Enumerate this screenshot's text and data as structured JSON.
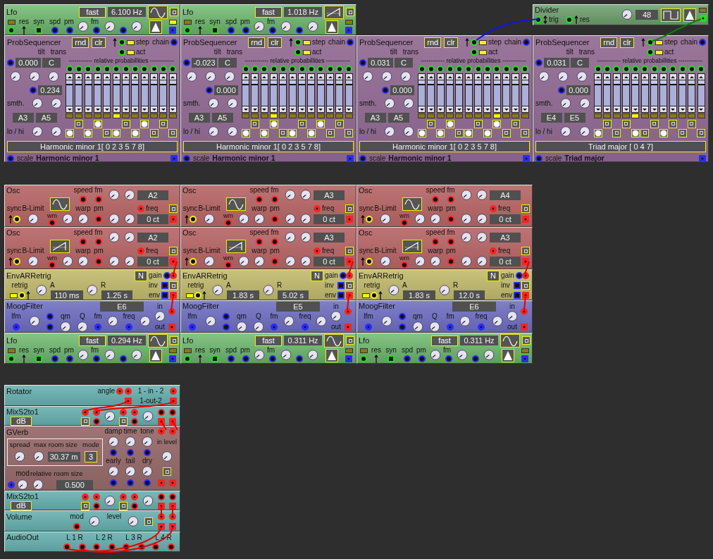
{
  "top_row": [
    {
      "kind": "lfo",
      "title": "Lfo",
      "mode": "fast",
      "rate": "6.100 Hz",
      "waveform": {
        "kind": "sine"
      },
      "led_on": true,
      "res": "res",
      "syn": "syn",
      "spd": "spd",
      "pm": "pm",
      "fm": "fm"
    },
    {
      "kind": "lfo",
      "title": "Lfo",
      "mode": "fast",
      "rate": "1.018 Hz",
      "waveform": {
        "kind": "saw"
      },
      "led_on": false,
      "res": "res",
      "syn": "syn",
      "spd": "spd",
      "pm": "pm",
      "fm": "fm"
    },
    {
      "kind": "divider",
      "title": "Divider",
      "trig": "trig",
      "res": "res",
      "value": "48"
    }
  ],
  "sequencers": [
    {
      "title": "ProbSequencer",
      "rnd": "rnd",
      "clr": "clr",
      "step": "step",
      "chain": "chain",
      "act": "act",
      "tilt_label": "tilt",
      "trans_label": "trans",
      "tilt": "0.000",
      "trans": "C",
      "heading": "------------ relative probabillities ------------",
      "smooth_label": "smth.",
      "smooth": "0.234",
      "lo": "A3",
      "hi": "A5",
      "range_label": "lo / hi",
      "scale_display": "Harmonic minor 1[ 0 2 3 5 7 8]",
      "scale_label": "scale",
      "scale_name": "Harmonic minor 1",
      "steps": [
        {
          "level": 0.74,
          "active": false,
          "on": true
        },
        {
          "level": 0.74,
          "active": false,
          "on": false
        },
        {
          "level": 0.74,
          "active": false,
          "on": true
        },
        {
          "level": 0.74,
          "active": false,
          "on": true
        },
        {
          "level": 0.74,
          "active": false,
          "on": false
        },
        {
          "level": 0.74,
          "active": true,
          "on": true
        },
        {
          "level": 0.74,
          "active": false,
          "on": false
        },
        {
          "level": 0.74,
          "active": false,
          "on": true
        },
        {
          "level": 0.74,
          "active": false,
          "on": true
        },
        {
          "level": 0.74,
          "active": false,
          "on": false
        },
        {
          "level": 0.74,
          "active": false,
          "on": false
        },
        {
          "level": 0.74,
          "active": false,
          "on": false
        }
      ]
    },
    {
      "title": "ProbSequencer",
      "rnd": "rnd",
      "clr": "clr",
      "step": "step",
      "chain": "chain",
      "act": "act",
      "tilt_label": "tilt",
      "trans_label": "trans",
      "tilt": "-0.023",
      "trans": "C",
      "heading": "------------ relative probabillities ------------",
      "smooth_label": "smth.",
      "smooth": "0.000",
      "lo": "A3",
      "hi": "A5",
      "range_label": "lo / hi",
      "scale_display": "Harmonic minor 1[ 0 2 3 5 7 8]",
      "scale_label": "scale",
      "scale_name": "Harmonic minor 1",
      "steps": [
        {
          "level": 0.74,
          "active": false,
          "on": true
        },
        {
          "level": 0.74,
          "active": false,
          "on": false
        },
        {
          "level": 0.74,
          "active": false,
          "on": true
        },
        {
          "level": 0.74,
          "active": true,
          "on": true
        },
        {
          "level": 0.74,
          "active": false,
          "on": false
        },
        {
          "level": 0.74,
          "active": false,
          "on": true
        },
        {
          "level": 0.74,
          "active": false,
          "on": false
        },
        {
          "level": 0.74,
          "active": false,
          "on": true
        },
        {
          "level": 0.74,
          "active": false,
          "on": true
        },
        {
          "level": 0.74,
          "active": false,
          "on": false
        },
        {
          "level": 0.74,
          "active": false,
          "on": false
        },
        {
          "level": 0.74,
          "active": false,
          "on": false
        }
      ]
    },
    {
      "title": "ProbSequencer",
      "rnd": "rnd",
      "clr": "clr",
      "step": "step",
      "chain": "chain",
      "act": "act",
      "tilt_label": "tilt",
      "trans_label": "trans",
      "tilt": "0.031",
      "trans": "C",
      "heading": "------------ relative probabillities ------------",
      "smooth_label": "smth.",
      "smooth": "0.000",
      "lo": "A3",
      "hi": "A5",
      "range_label": "lo / hi",
      "scale_display": "Harmonic minor 1[ 0 2 3 5 7 8]",
      "scale_label": "scale",
      "scale_name": "Harmonic minor 1",
      "steps": [
        {
          "level": 0.74,
          "active": false,
          "on": true
        },
        {
          "level": 0.74,
          "active": false,
          "on": false
        },
        {
          "level": 0.74,
          "active": false,
          "on": true
        },
        {
          "level": 0.74,
          "active": false,
          "on": true
        },
        {
          "level": 0.74,
          "active": false,
          "on": false
        },
        {
          "level": 0.74,
          "active": false,
          "on": true
        },
        {
          "level": 0.74,
          "active": false,
          "on": false
        },
        {
          "level": 0.74,
          "active": false,
          "on": true
        },
        {
          "level": 0.74,
          "active": true,
          "on": true
        },
        {
          "level": 0.74,
          "active": false,
          "on": false
        },
        {
          "level": 0.74,
          "active": false,
          "on": false
        },
        {
          "level": 0.74,
          "active": false,
          "on": false
        }
      ]
    },
    {
      "title": "ProbSequencer",
      "rnd": "rnd",
      "clr": "clr",
      "step": "step",
      "chain": "chain",
      "act": "act",
      "tilt_label": "tilt",
      "trans_label": "trans",
      "tilt": "0.031",
      "trans": "C",
      "heading": "------------ relative probabillities ------------",
      "smooth_label": "smth.",
      "smooth": "0.000",
      "lo": "E4",
      "hi": "E5",
      "range_label": "lo / hi",
      "scale_display": "Triad major [ 0 4 7]",
      "scale_label": "scale",
      "scale_name": "Triad major",
      "steps": [
        {
          "level": 0.74,
          "active": false,
          "on": true
        },
        {
          "level": 0.74,
          "active": false,
          "on": false
        },
        {
          "level": 0.74,
          "active": false,
          "on": false
        },
        {
          "level": 0.74,
          "active": false,
          "on": false
        },
        {
          "level": 0.74,
          "active": true,
          "on": true
        },
        {
          "level": 0.74,
          "active": false,
          "on": false
        },
        {
          "level": 0.74,
          "active": false,
          "on": false
        },
        {
          "level": 0.74,
          "active": false,
          "on": true
        },
        {
          "level": 0.74,
          "active": false,
          "on": false
        },
        {
          "level": 0.74,
          "active": false,
          "on": false
        },
        {
          "level": 0.74,
          "active": false,
          "on": false
        },
        {
          "level": 0.74,
          "active": false,
          "on": false
        }
      ]
    }
  ],
  "voice_rows": [
    [
      {
        "kind": "osc",
        "title": "Osc",
        "speed": "speed",
        "fm": "fm",
        "blimit": "B-Limit",
        "wm": "wm",
        "warp": "warp",
        "pm": "pm",
        "sync": "sync",
        "freq": "freq",
        "note": "A2",
        "tune": "0 ct",
        "waveform": {
          "kind": "sine"
        }
      },
      {
        "kind": "osc",
        "title": "Osc",
        "speed": "speed",
        "fm": "fm",
        "blimit": "B-Limit",
        "wm": "wm",
        "warp": "warp",
        "pm": "pm",
        "sync": "sync",
        "freq": "freq",
        "note": "A3",
        "tune": "0 ct",
        "waveform": {
          "kind": "sine"
        }
      },
      {
        "kind": "osc",
        "title": "Osc",
        "speed": "speed",
        "fm": "fm",
        "blimit": "B-Limit",
        "wm": "wm",
        "warp": "warp",
        "pm": "pm",
        "sync": "sync",
        "freq": "freq",
        "note": "A4",
        "tune": "0 ct",
        "waveform": {
          "kind": "sine"
        }
      }
    ],
    [
      {
        "kind": "osc",
        "title": "Osc",
        "speed": "speed",
        "fm": "fm",
        "blimit": "B-Limit",
        "wm": "wm",
        "warp": "warp",
        "pm": "pm",
        "sync": "sync",
        "freq": "freq",
        "note": "A2",
        "tune": "0 ct",
        "waveform": {
          "kind": "saw"
        }
      },
      {
        "kind": "osc",
        "title": "Osc",
        "speed": "speed",
        "fm": "fm",
        "blimit": "B-Limit",
        "wm": "wm",
        "warp": "warp",
        "pm": "pm",
        "sync": "sync",
        "freq": "freq",
        "note": "A3",
        "tune": "0 ct",
        "waveform": {
          "kind": "saw"
        }
      },
      {
        "kind": "osc",
        "title": "Osc",
        "speed": "speed",
        "fm": "fm",
        "blimit": "B-Limit",
        "wm": "wm",
        "warp": "warp",
        "pm": "pm",
        "sync": "sync",
        "freq": "freq",
        "note": "A3",
        "tune": "0 ct",
        "waveform": {
          "kind": "saw"
        }
      }
    ],
    [
      {
        "kind": "env",
        "title": "EnvARRetrig",
        "retrig": "retrig",
        "attack_label": "A",
        "attack": "110 ms",
        "release_label": "R",
        "release": "1.25 s",
        "mode": "N",
        "gain": "gain",
        "inv": "inv",
        "env": "env"
      },
      {
        "kind": "env",
        "title": "EnvARRetrig",
        "retrig": "retrig",
        "attack_label": "A",
        "attack": "1.83 s",
        "release_label": "R",
        "release": "5.02 s",
        "mode": "N",
        "gain": "gain",
        "inv": "inv",
        "env": "env"
      },
      {
        "kind": "env",
        "title": "EnvARRetrig",
        "retrig": "retrig",
        "attack_label": "A",
        "attack": "1.83 s",
        "release_label": "R",
        "release": "12.0 s",
        "mode": "N",
        "gain": "gain",
        "inv": "inv",
        "env": "env"
      }
    ],
    [
      {
        "kind": "moog",
        "title": "MoogFilter",
        "cutoff": "E6",
        "lfm": "lfm",
        "qm": "qm",
        "q": "Q",
        "fm": "fm",
        "freq": "freq",
        "in": "in",
        "out": "out"
      },
      {
        "kind": "moog",
        "title": "MoogFilter",
        "cutoff": "E5",
        "lfm": "lfm",
        "qm": "qm",
        "q": "Q",
        "fm": "fm",
        "freq": "freq",
        "in": "in",
        "out": "out"
      },
      {
        "kind": "moog",
        "title": "MoogFilter",
        "cutoff": "E6",
        "lfm": "lfm",
        "qm": "qm",
        "q": "Q",
        "fm": "fm",
        "freq": "freq",
        "in": "in",
        "out": "out"
      }
    ],
    [
      {
        "kind": "lfo",
        "title": "Lfo",
        "mode": "fast",
        "rate": "0.294 Hz",
        "waveform": {
          "kind": "sine"
        },
        "led_on": false,
        "res": "res",
        "syn": "syn",
        "spd": "spd",
        "pm": "pm",
        "fm": "fm"
      },
      {
        "kind": "lfo",
        "title": "Lfo",
        "mode": "fast",
        "rate": "0.311 Hz",
        "waveform": {
          "kind": "sine"
        },
        "led_on": false,
        "res": "res",
        "syn": "syn",
        "spd": "spd",
        "pm": "pm",
        "fm": "fm"
      },
      {
        "kind": "lfo",
        "title": "Lfo",
        "mode": "fast",
        "rate": "0.311 Hz",
        "waveform": {
          "kind": "sine"
        },
        "led_on": false,
        "res": "res",
        "syn": "syn",
        "spd": "spd",
        "pm": "pm",
        "fm": "fm"
      }
    ]
  ],
  "fx_chain": [
    {
      "kind": "rotator",
      "title": "Rotator",
      "angle": "angle",
      "inputs": "1 - in - 2",
      "outputs": "1-out-2"
    },
    {
      "kind": "mix",
      "title": "MixS2to1",
      "unit": "dB"
    },
    {
      "kind": "gverb",
      "title": "GVerb",
      "spread": "spread",
      "max_room_label": "max room size",
      "mode_label": "mode",
      "max_room": "30.37 m",
      "mode": "3",
      "damp": "damp",
      "time": "time",
      "tone": "tone",
      "in_level": "in level",
      "early": "early",
      "tail": "tail",
      "dry": "dry",
      "mod": "mod",
      "room_label": "relative room size",
      "room": "0.500"
    },
    {
      "kind": "mix",
      "title": "MixS2to1",
      "unit": "dB"
    },
    {
      "kind": "volume",
      "title": "Volume",
      "mod": "mod",
      "level_label": "level"
    },
    {
      "kind": "audioout",
      "title": "AudioOut",
      "channels": [
        "L 1 R",
        "L 2 R",
        "L 3 R",
        "L 4 R"
      ]
    }
  ]
}
